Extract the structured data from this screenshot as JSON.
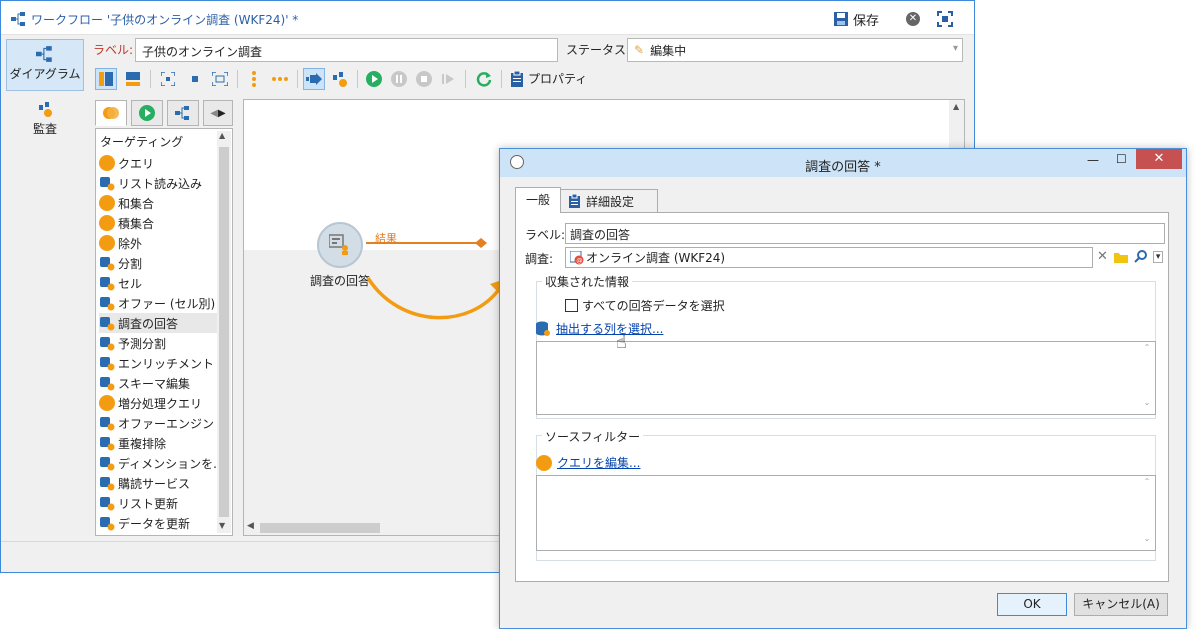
{
  "main_window": {
    "title": "ワークフロー '子供のオンライン調査 (WKF24)' *",
    "save_label": "保存",
    "nav": {
      "diagram": "ダイアグラム",
      "monitoring": "監査"
    },
    "label_caption": "ラベル:",
    "label_value": "子供のオンライン調査",
    "status_caption": "ステータス:",
    "status_value": "編集中",
    "properties_label": "プロパティ"
  },
  "palette": {
    "header": "ターゲティング",
    "items": [
      {
        "label": "クエリ",
        "icon": "query-icon"
      },
      {
        "label": "リスト読み込み",
        "icon": "list-load-icon"
      },
      {
        "label": "和集合",
        "icon": "union-icon"
      },
      {
        "label": "積集合",
        "icon": "intersection-icon"
      },
      {
        "label": "除外",
        "icon": "exclusion-icon"
      },
      {
        "label": "分割",
        "icon": "split-icon"
      },
      {
        "label": "セル",
        "icon": "cell-icon"
      },
      {
        "label": "オファー (セル別)",
        "icon": "offer-cell-icon"
      },
      {
        "label": "調査の回答",
        "icon": "survey-answers-icon"
      },
      {
        "label": "予測分割",
        "icon": "predictive-split-icon"
      },
      {
        "label": "エンリッチメント",
        "icon": "enrichment-icon"
      },
      {
        "label": "スキーマ編集",
        "icon": "schema-edit-icon"
      },
      {
        "label": "増分処理クエリ",
        "icon": "incremental-query-icon"
      },
      {
        "label": "オファーエンジン",
        "icon": "offer-engine-icon"
      },
      {
        "label": "重複排除",
        "icon": "deduplication-icon"
      },
      {
        "label": "ディメンションを...",
        "icon": "dimension-icon"
      },
      {
        "label": "購読サービス",
        "icon": "subscription-icon"
      },
      {
        "label": "リスト更新",
        "icon": "list-update-icon"
      },
      {
        "label": "データを更新",
        "icon": "data-update-icon"
      }
    ],
    "selected_index": 8
  },
  "canvas": {
    "activity_label": "調査の回答",
    "transition_label": "結果"
  },
  "dialog": {
    "title": "調査の回答 *",
    "tabs": [
      "一般",
      "詳細設定"
    ],
    "label_caption": "ラベル:",
    "label_value": "調査の回答",
    "survey_caption": "調査:",
    "survey_value": "オンライン調査 (WKF24)",
    "collected_group": "収集された情報",
    "select_all_label": "すべての回答データを選択",
    "select_all_checked": false,
    "select_columns_link": "抽出する列を選択...",
    "source_filter_group": "ソースフィルター",
    "edit_query_link": "クエリを編集...",
    "ok_label": "OK",
    "cancel_label": "キャンセル(A)"
  },
  "colors": {
    "accent": "#3c8ad9",
    "orange": "#f39c12",
    "green": "#27ae60",
    "link": "#0645ad",
    "close_red": "#c75050"
  }
}
